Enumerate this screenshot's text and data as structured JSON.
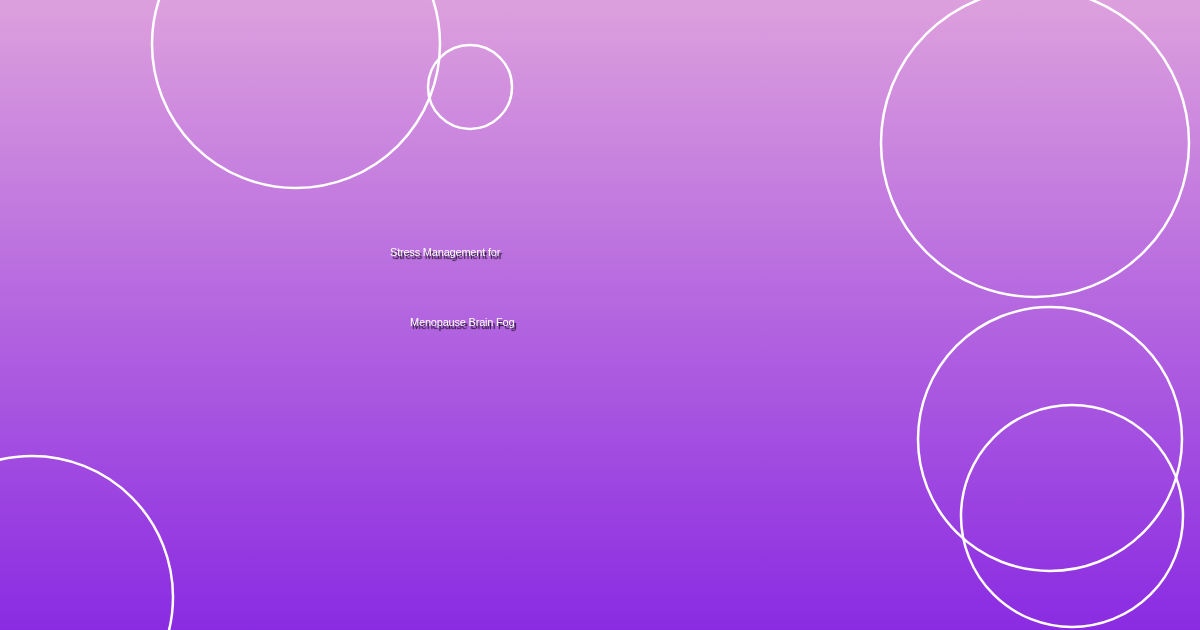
{
  "title_lines": [
    "Stress Management for",
    "Menopause Brain Fog"
  ]
}
